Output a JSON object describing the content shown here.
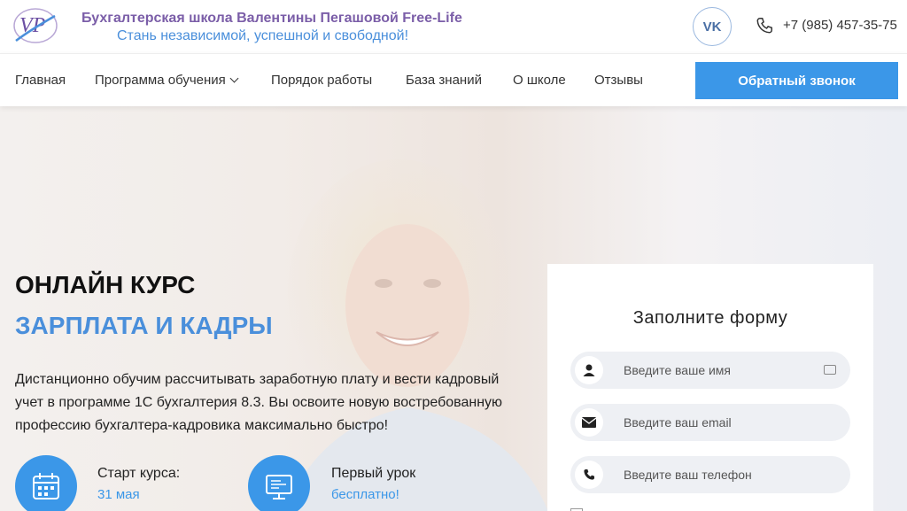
{
  "header": {
    "logo_text": "VP",
    "school_name": "Бухгалтерская школа Валентины Пегашовой Free-Life",
    "slogan": "Стань независимой, успешной и свободной!",
    "vk_label": "VK",
    "phone": "+7 (985) 457-35-75"
  },
  "nav": {
    "items": [
      {
        "label": "Главная"
      },
      {
        "label": "Программа обучения"
      },
      {
        "label": "Порядок работы"
      },
      {
        "label": "База знаний"
      },
      {
        "label": "О школе"
      },
      {
        "label": "Отзывы"
      }
    ],
    "callback_label": "Обратный звонок"
  },
  "hero": {
    "headline_line1": "ОНЛАЙН КУРС",
    "headline_line2": "ЗАРПЛАТА И КАДРЫ",
    "description": "Дистанционно обучим рассчитывать заработную плату и вести кадровый учет в программе 1С бухгалтерия 8.3. Вы освоите новую востребованную профессию бухгалтера-кадровика максимально быстро!",
    "features": [
      {
        "title": "Старт курса:",
        "value": "31 мая",
        "icon": "calendar-icon"
      },
      {
        "title": "Первый урок",
        "value": "бесплатно!",
        "icon": "monitor-icon"
      }
    ]
  },
  "form": {
    "title": "Заполните форму",
    "name_placeholder": "Введите ваше имя",
    "email_placeholder": "Введите ваш email",
    "phone_placeholder": "Введите ваш телефон"
  },
  "colors": {
    "accent": "#3b97e8",
    "brand_purple": "#7b5ea8",
    "slogan_blue": "#4a8fdb"
  }
}
